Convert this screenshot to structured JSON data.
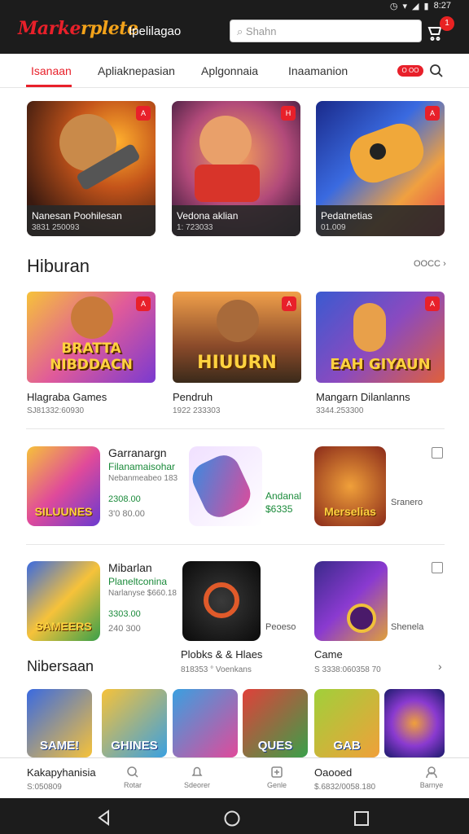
{
  "status": {
    "time": "8:27"
  },
  "header": {
    "logo_a": "Marke",
    "logo_b": "rplete",
    "subtitle": "Ipelilagao",
    "search_placeholder": "Shahn",
    "cart_badge": "1"
  },
  "tabs": [
    {
      "label": "Isanaan"
    },
    {
      "label": "Apliaknepasian"
    },
    {
      "label": "Aplgonnaia"
    },
    {
      "label": "Inaamanion"
    }
  ],
  "tab_pill": "O OO",
  "featured": [
    {
      "title": "Nanesan Poohilesan",
      "sub": "3831 250093",
      "badge": "A"
    },
    {
      "title": "Vedona aklian",
      "sub": "1: 723033",
      "badge": "H"
    },
    {
      "title": "Pedatnetias",
      "sub": "01.009",
      "badge": "A"
    }
  ],
  "section1": {
    "title": "Hiburan",
    "more": "OOCC"
  },
  "cards": [
    {
      "word": "BRATTA NIBDDACN",
      "name": "Hlagraba Games",
      "meta": "SJ81332:60930",
      "badge": "A"
    },
    {
      "word": "HIUURN",
      "name": "Pendruh",
      "meta": "1922 233303",
      "badge": "A"
    },
    {
      "word": "EAH GIYAUN",
      "name": "Mangarn Dilanlanns",
      "meta": "3344.253300",
      "badge": "A"
    }
  ],
  "row1": {
    "icon_word": "SILUUNES",
    "title": "Garranargn",
    "green": "Filanamaisohar",
    "meta": "Nebanmeabeo 183",
    "price": "2308.00",
    "price2": "3'0 80.00",
    "mid_title": "Andanal",
    "mid_price": "$6335",
    "right_word": "Merselias",
    "right_label": "Sranero"
  },
  "row2": {
    "icon_word": "SAMEERS",
    "title": "Mibarlan",
    "green": "Planeltconina",
    "meta": "Narlanyse $660.18",
    "price": "3303.00",
    "price2": "240 300",
    "mid_label": "Peoeso",
    "mid_name": "Plobks & & Hlaes",
    "mid_meta": "818353 ° Voenkans",
    "right_label": "Shenela",
    "right_name": "Came",
    "right_meta": "S 3338:060358 70"
  },
  "section2": {
    "title": "Nibersaan"
  },
  "thumbs": [
    {
      "word": "SAME!"
    },
    {
      "word": "GHINES"
    },
    {
      "word": ""
    },
    {
      "word": "QUES"
    },
    {
      "word": "GAB"
    },
    {
      "word": ""
    }
  ],
  "bottom": {
    "left_title": "Kakapyhanisia",
    "left_meta": "S:050809",
    "right_title": "Oaooed",
    "right_meta": "$.6832/0058.180",
    "nav": [
      "Rotar",
      "Sdeorer",
      "Genle",
      "Barnye"
    ]
  },
  "colors": {
    "accent": "#e8202a",
    "green": "#1a8a3a"
  }
}
